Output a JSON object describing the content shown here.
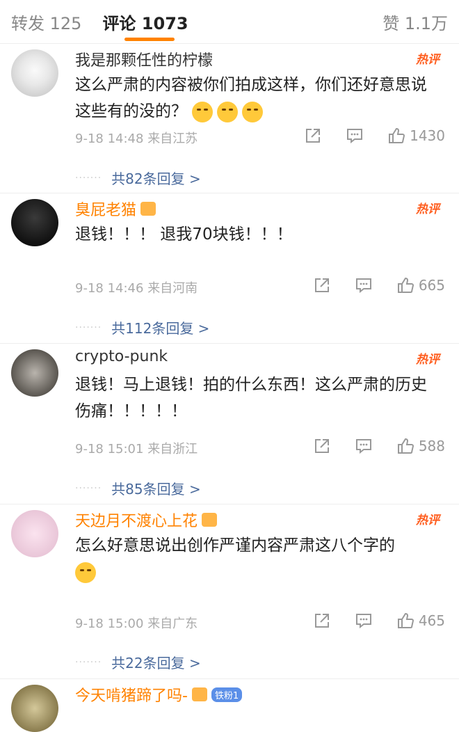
{
  "tabs": {
    "repost": "转发 125",
    "comments": "评论 1073",
    "likes": "赞 1.1万"
  },
  "comments": [
    {
      "name": "我是那颗任性的柠檬",
      "name_color": "#333333",
      "hot": "热评",
      "text": "这么严肃的内容被你们拍成这样，你们还好意思说这些有的没的？",
      "time": "9-18 14:48",
      "location": "来自江苏",
      "likes": "1430",
      "replies": "共82条回复 >"
    },
    {
      "name": "臭屁老猫",
      "name_color": "#ff8200",
      "hot": "热评",
      "text": "退钱！！！ 退我70块钱！！！",
      "time": "9-18 14:46",
      "location": "来自河南",
      "likes": "665",
      "replies": "共112条回复 >"
    },
    {
      "name": "crypto-punk",
      "name_color": "#333333",
      "hot": "热评",
      "text": "退钱！马上退钱！拍的什么东西！这么严肃的历史伤痛！！！！！",
      "time": "9-18 15:01",
      "location": "来自浙江",
      "likes": "588",
      "replies": "共85条回复 >"
    },
    {
      "name": "天边月不渡心上花",
      "name_color": "#ff8200",
      "hot": "热评",
      "text": "怎么好意思说出创作严谨内容严肃这八个字的",
      "time": "9-18 15:00",
      "location": "来自广东",
      "likes": "465",
      "replies": "共22条回复 >"
    },
    {
      "name": "今天啃猪蹄了吗-",
      "name_color": "#ff8200",
      "fan_badge": "铁粉1"
    }
  ]
}
